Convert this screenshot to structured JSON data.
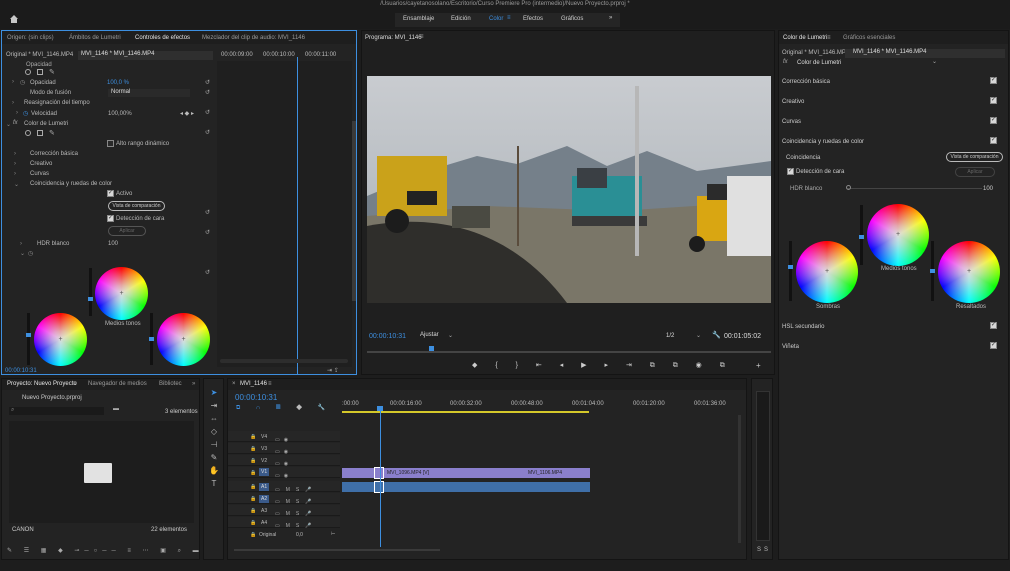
{
  "window": {
    "title": "/Usuarios/cayetanosolano/Escritorio/Curso Premiere Pro (intermedio)/Nuevo Proyecto.prproj *"
  },
  "workspaces": {
    "items": [
      "Ensamblaje",
      "Edición",
      "Color",
      "Efectos",
      "Gráficos"
    ],
    "active": "Color",
    "more": "»"
  },
  "source_panel": {
    "tabs": [
      "Origen: (sin clips)",
      "Ámbitos de Lumetri",
      "Controles de efectos",
      "Mezclador del clip de audio: MVI_1146"
    ],
    "clip_selector": {
      "master": "Original * MVI_1146.MP4",
      "selected": "MVI_1146 * MVI_1146.MP4"
    },
    "ruler": [
      "00:00:09:00",
      "00:00:10:00",
      "00:00:11:00"
    ],
    "rows": {
      "opacity_header": "Opacidad",
      "opacity_label": "Opacidad",
      "opacity_value": "100,0 %",
      "blend_label": "Modo de fusión",
      "blend_value": "Normal",
      "time_remap": "Reasignación del tiempo",
      "speed_label": "Velocidad",
      "speed_value": "100,00%",
      "lumetri": "Color de Lumetri",
      "hdr_toggle": "Alto rango dinámico",
      "basic": "Corrección básica",
      "creative": "Creativo",
      "curves": "Curvas",
      "wheels": "Coincidencia y ruedas de color",
      "active": "Activo",
      "compare": "Vista de comparación",
      "face": "Detección de cara",
      "apply": "Aplicar",
      "hdr_white_label": "HDR blanco",
      "hdr_white_value": "100",
      "mid_label": "Medios tonos"
    },
    "timecode": "00:00:10:31"
  },
  "program": {
    "title": "Programa: MVI_1146",
    "timecode": "00:00:10:31",
    "fit": "Ajustar",
    "resolution": "1/2",
    "duration": "00:01:05:02"
  },
  "lumetri_panel": {
    "tabs": [
      "Color de Lumetri",
      "Gráficos esenciales"
    ],
    "clip_selector": {
      "master": "Original * MVI_1146.MP4",
      "selected": "MVI_1146 * MVI_1146.MP4"
    },
    "fx_name": "Color de Lumetri",
    "sections": [
      "Corrección básica",
      "Creativo",
      "Curvas",
      "Coincidencia y ruedas de color"
    ],
    "match_label": "Coincidencia",
    "compare": "Vista de comparación",
    "face": "Detección de cara",
    "apply": "Aplicar",
    "hdr_white_label": "HDR blanco",
    "hdr_white_value": "100",
    "shadows": "Sombras",
    "midtones": "Medios tonos",
    "highlights": "Resaltados",
    "hsl": "HSL secundario",
    "vignette": "Viñeta"
  },
  "project_panel": {
    "tabs": [
      "Proyecto: Nuevo Proyecto",
      "Navegador de medios",
      "Bibliotec"
    ],
    "file": "Nuevo Proyecto.prproj",
    "count": "3 elementos",
    "bin_name": "CANON",
    "bin_count": "22 elementos"
  },
  "timeline": {
    "title": "MVI_1146",
    "timecode": "00:00:10:31",
    "ruler": [
      ":00:00",
      "00:00:16:00",
      "00:00:32:00",
      "00:00:48:00",
      "00:01:04:00",
      "00:01:20:00",
      "00:01:36:00"
    ],
    "video_tracks": [
      "V4",
      "V3",
      "V2",
      "V1"
    ],
    "audio_tracks": [
      "A1",
      "A2",
      "A3",
      "A4"
    ],
    "clip1": "MVI_1096.MP4 [V]",
    "clip2": "MVI_1106.MP4",
    "master_label": "Original",
    "master_value": "0,0"
  },
  "meter": {
    "labels": [
      "S",
      "S"
    ]
  }
}
